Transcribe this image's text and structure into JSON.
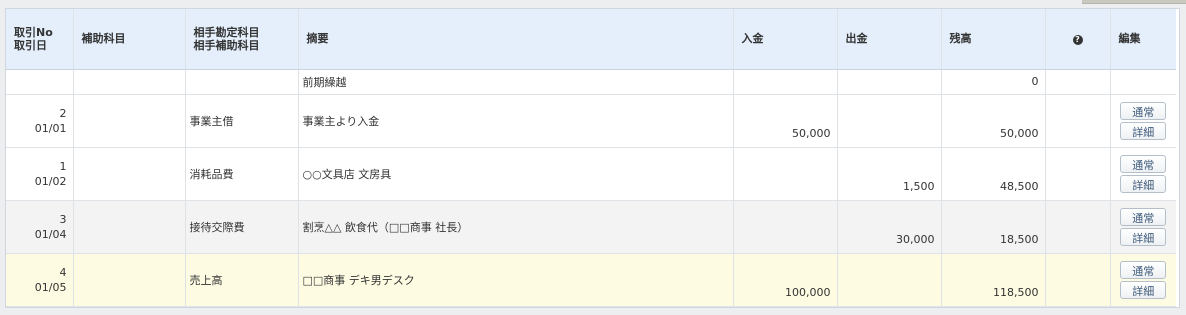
{
  "header": {
    "no_line1": "取引No",
    "no_line2": "取引日",
    "sub_account": "補助科目",
    "counter_line1": "相手勘定科目",
    "counter_line2": "相手補助科目",
    "description": "摘要",
    "deposit": "入金",
    "withdrawal": "出金",
    "balance": "残高",
    "help": "?",
    "edit": "編集"
  },
  "carry_over": {
    "description": "前期繰越",
    "balance": "0"
  },
  "buttons": {
    "normal": "通常",
    "detail": "詳細"
  },
  "rows": [
    {
      "no": "2",
      "date": "01/01",
      "sub_account": "",
      "counter": "事業主借",
      "description": "事業主より入金",
      "deposit": "50,000",
      "withdrawal": "",
      "balance": "50,000",
      "bg": "white"
    },
    {
      "no": "1",
      "date": "01/02",
      "sub_account": "",
      "counter": "消耗品費",
      "description": "○○文具店 文房具",
      "deposit": "",
      "withdrawal": "1,500",
      "balance": "48,500",
      "bg": "white"
    },
    {
      "no": "3",
      "date": "01/04",
      "sub_account": "",
      "counter": "接待交際費",
      "description": "割烹△△ 飲食代（□□商事 社長）",
      "deposit": "",
      "withdrawal": "30,000",
      "balance": "18,500",
      "bg": "grey"
    },
    {
      "no": "4",
      "date": "01/05",
      "sub_account": "",
      "counter": "売上高",
      "description": "□□商事 デキ男デスク",
      "deposit": "100,000",
      "withdrawal": "",
      "balance": "118,500",
      "bg": "yellow"
    }
  ]
}
